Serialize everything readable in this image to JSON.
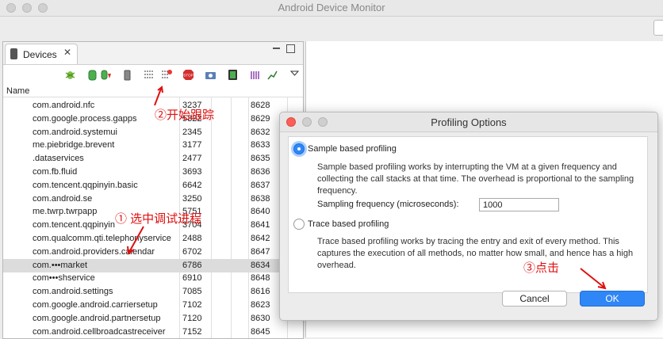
{
  "window": {
    "title": "Android Device Monitor"
  },
  "devices_panel": {
    "tab_label": "Devices",
    "column_header": "Name",
    "rows": [
      {
        "name": "com.android.nfc",
        "pid": "3237",
        "port": "8628"
      },
      {
        "name": "com.google.process.gapps",
        "pid": "5322",
        "port": "8629"
      },
      {
        "name": "com.android.systemui",
        "pid": "2345",
        "port": "8632"
      },
      {
        "name": "me.piebridge.brevent",
        "pid": "3177",
        "port": "8633"
      },
      {
        "name": ".dataservices",
        "pid": "2477",
        "port": "8635"
      },
      {
        "name": "com.fb.fluid",
        "pid": "3693",
        "port": "8636"
      },
      {
        "name": "com.tencent.qqpinyin.basic",
        "pid": "6642",
        "port": "8637"
      },
      {
        "name": "com.android.se",
        "pid": "3250",
        "port": "8638"
      },
      {
        "name": "me.twrp.twrpapp",
        "pid": "5751",
        "port": "8640"
      },
      {
        "name": "com.tencent.qqpinyin",
        "pid": "3704",
        "port": "8641"
      },
      {
        "name": "com.qualcomm.qti.telephonyservice",
        "pid": "2488",
        "port": "8642"
      },
      {
        "name": "com.android.providers.calendar",
        "pid": "6702",
        "port": "8647"
      },
      {
        "name": "com.•••market",
        "pid": "6786",
        "port": "8634"
      },
      {
        "name": "com•••shservice",
        "pid": "6910",
        "port": "8648"
      },
      {
        "name": "com.android.settings",
        "pid": "7085",
        "port": "8616"
      },
      {
        "name": "com.google.android.carriersetup",
        "pid": "7102",
        "port": "8623"
      },
      {
        "name": "com.google.android.partnersetup",
        "pid": "7120",
        "port": "8630"
      },
      {
        "name": "com.android.cellbroadcastreceiver",
        "pid": "7152",
        "port": "8645"
      }
    ]
  },
  "dialog": {
    "title": "Profiling Options",
    "sample_label": "Sample based profiling",
    "sample_desc": "Sample based profiling works by interrupting the VM at a given frequency and collecting the call stacks at that time. The overhead is proportional to the sampling frequency.",
    "freq_label": "Sampling frequency (microseconds):",
    "freq_value": "1000",
    "trace_label": "Trace based profiling",
    "trace_desc": "Trace based profiling works by tracing the entry and exit of every method. This captures the execution of all methods, no matter how small, and hence has a high overhead.",
    "cancel_label": "Cancel",
    "ok_label": "OK",
    "selected_option": "sample"
  },
  "annotations": {
    "step1": "① 选中调试进程",
    "step2": "②开始跟踪",
    "step3": "③点击"
  },
  "colors": {
    "accent": "#2f86f6",
    "annotation": "#e01010"
  }
}
